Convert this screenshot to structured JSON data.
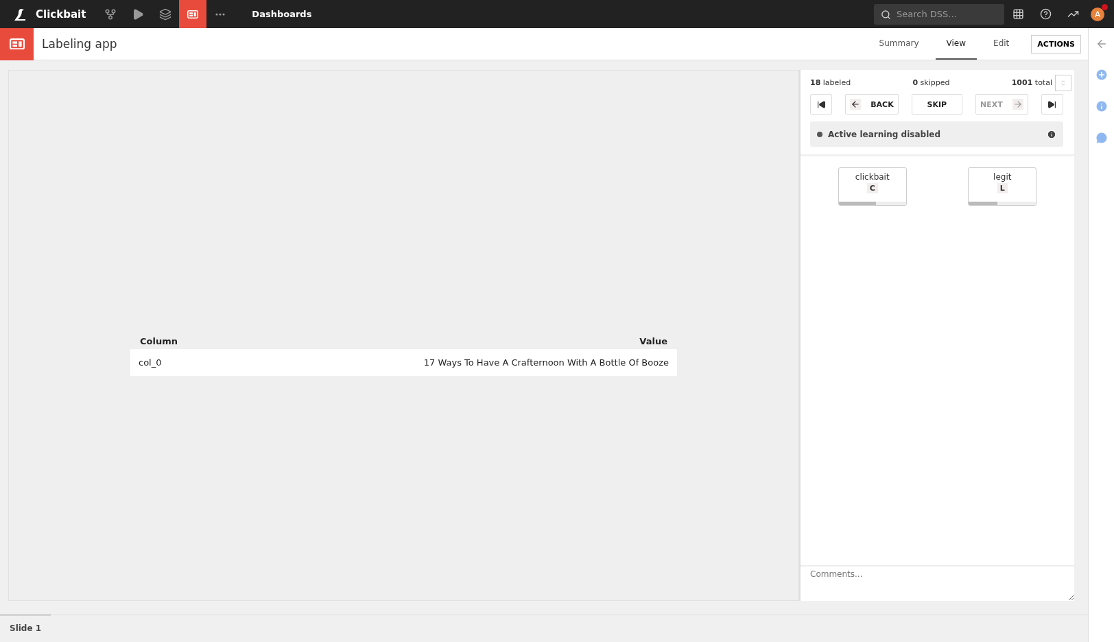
{
  "topbar": {
    "project": "Clickbait",
    "nav": [
      {
        "kind": "flow",
        "selected": false
      },
      {
        "kind": "run",
        "selected": false
      },
      {
        "kind": "stack",
        "selected": false
      },
      {
        "kind": "dashboard",
        "selected": true
      },
      {
        "kind": "more",
        "selected": false
      }
    ],
    "breadcrumb": "Dashboards",
    "search": {
      "placeholder": "Search DSS..."
    },
    "avatar": "A",
    "notification": true
  },
  "header": {
    "title": "Labeling app",
    "tabs": [
      {
        "label": "Summary",
        "selected": false
      },
      {
        "label": "View",
        "selected": true
      },
      {
        "label": "Edit",
        "selected": false
      }
    ],
    "actions": "ACTIONS"
  },
  "record": {
    "columns": [
      "Column",
      "Value"
    ],
    "rows": [
      [
        "col_0",
        "17 Ways To Have A Crafternoon With A Bottle Of Booze"
      ]
    ]
  },
  "labeling": {
    "stats": [
      {
        "count": "18",
        "label": "labeled"
      },
      {
        "count": "0",
        "label": "skipped"
      },
      {
        "count": "1001",
        "label": "total"
      }
    ],
    "controls": [
      {
        "kind": "first",
        "disabled": false
      },
      {
        "kind": "back",
        "label": "BACK",
        "disabled": false
      },
      {
        "kind": "skip",
        "label": "SKIP",
        "disabled": false
      },
      {
        "kind": "next",
        "label": "NEXT",
        "disabled": true
      },
      {
        "kind": "last",
        "disabled": false
      }
    ],
    "status": {
      "text": "Active learning disabled",
      "on": false
    },
    "labels": [
      {
        "name": "clickbait",
        "key": "C",
        "level": 0.55
      },
      {
        "name": "legit",
        "key": "L",
        "level": 0.43
      }
    ],
    "comments": {
      "placeholder": "Comments..."
    }
  },
  "rail": [
    {
      "kind": "add"
    },
    {
      "kind": "info"
    },
    {
      "kind": "chat"
    }
  ],
  "slides": [
    {
      "label": "Slide 1",
      "selected": true
    }
  ]
}
